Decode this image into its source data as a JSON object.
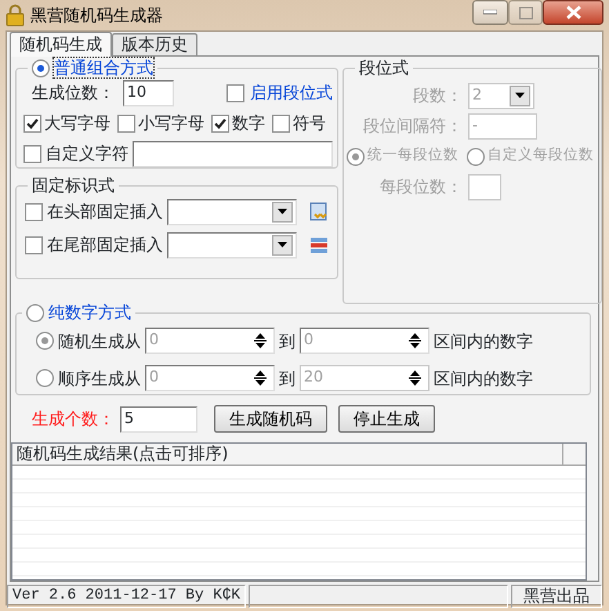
{
  "window": {
    "title": "黑营随机码生成器"
  },
  "tabs": [
    {
      "label": "随机码生成",
      "selected": true
    },
    {
      "label": "版本历史",
      "selected": false
    }
  ],
  "combo_mode": {
    "label": "普通组合方式",
    "selected": true,
    "length_label": "生成位数：",
    "length_value": "10",
    "segment_toggle": {
      "label": "启用段位式",
      "checked": false
    },
    "charsets": [
      {
        "label": "大写字母",
        "checked": true
      },
      {
        "label": "小写字母",
        "checked": false
      },
      {
        "label": "数字",
        "checked": true
      },
      {
        "label": "符号",
        "checked": false
      }
    ],
    "custom": {
      "label": "自定义字符",
      "checked": false
    }
  },
  "segment": {
    "title": "段位式",
    "disabled": true,
    "count_label": "段数：",
    "count_value": "2",
    "separator_label": "段位间隔符：",
    "separator_value": "-",
    "modes": [
      {
        "label": "统一每段位数",
        "selected": true
      },
      {
        "label": "自定义每段位数",
        "selected": false
      }
    ],
    "per_segment_label": "每段位数："
  },
  "fixed": {
    "title": "固定标识式",
    "rows": [
      {
        "label": "在头部固定插入",
        "checked": false
      },
      {
        "label": "在尾部固定插入",
        "checked": false
      }
    ]
  },
  "digits_mode": {
    "label": "纯数字方式",
    "selected": false,
    "rows": [
      {
        "label": "随机生成从",
        "selected": true,
        "from": "0",
        "to_label": "到",
        "to": "0",
        "suffix": "区间内的数字"
      },
      {
        "label": "顺序生成从",
        "selected": false,
        "from": "0",
        "to_label": "到",
        "to": "20",
        "suffix": "区间内的数字"
      }
    ]
  },
  "count": {
    "label": "生成个数：",
    "value": "5"
  },
  "buttons": [
    "生成随机码",
    "停止生成"
  ],
  "results": {
    "column": "随机码生成结果(点击可排序)"
  },
  "status_bar": {
    "version": "Ver 2.6 2011-12-17 By K₵K",
    "credit": "黑营出品"
  }
}
